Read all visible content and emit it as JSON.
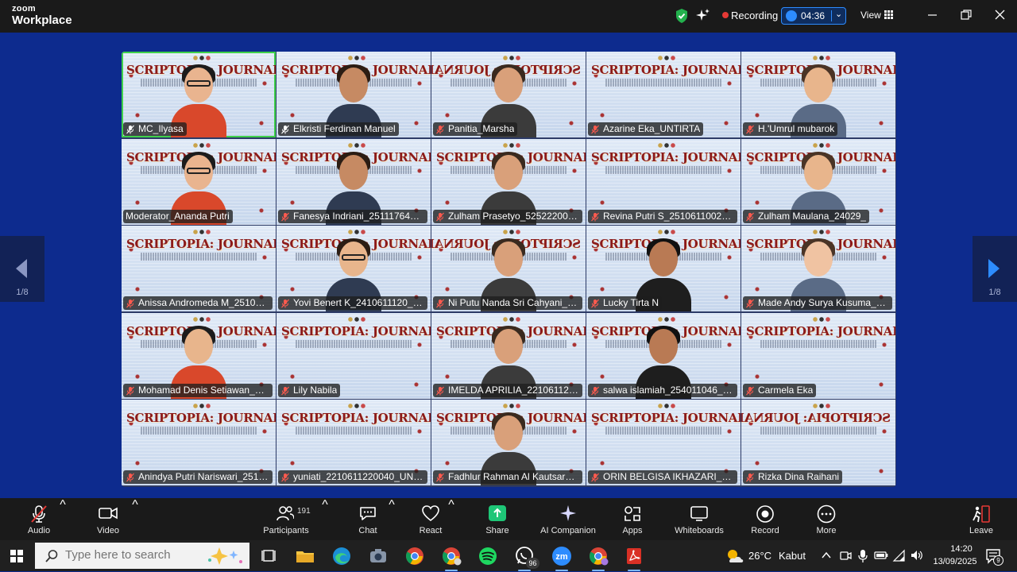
{
  "app": {
    "brand_top": "zoom",
    "brand_bottom": "Workplace"
  },
  "topbar": {
    "recording_label": "Recording",
    "timer": "04:36",
    "view_label": "View"
  },
  "pager": {
    "left_page": "1/8",
    "right_page": "1/8"
  },
  "participants": [
    {
      "name": "MC_Ilyasa",
      "mic": "pinned",
      "video": "person",
      "speaking": true
    },
    {
      "name": "Elkristi Ferdinan Manuel",
      "mic": "pinned",
      "video": "person"
    },
    {
      "name": "Panitia_Marsha",
      "mic": "muted",
      "video": "person",
      "mirrored": true
    },
    {
      "name": "Azarine Eka_UNTIRTA",
      "mic": "muted",
      "video": "banner"
    },
    {
      "name": "H.'Umrul mubarok",
      "mic": "muted",
      "video": "avatar"
    },
    {
      "name": "Moderator_Ananda Putri",
      "mic": "none",
      "video": "person"
    },
    {
      "name": "Fanesya Indriani_2511176403...",
      "mic": "muted",
      "video": "person"
    },
    {
      "name": "Zulham Prasetyo_5252220010...",
      "mic": "muted",
      "video": "person"
    },
    {
      "name": "Revina Putri S_2510611002_U...",
      "mic": "muted",
      "video": "banner"
    },
    {
      "name": "Zulham Maulana_24029_",
      "mic": "muted",
      "video": "avatar"
    },
    {
      "name": "Anissa Andromeda M_251061...",
      "mic": "muted",
      "video": "banner"
    },
    {
      "name": "Yovi Benert K_2410611120_UP...",
      "mic": "muted",
      "video": "avatar"
    },
    {
      "name": "Ni Putu Nanda Sri Cahyani_25...",
      "mic": "muted",
      "video": "person",
      "mirrored": true
    },
    {
      "name": "Lucky Tirta N",
      "mic": "muted",
      "video": "person"
    },
    {
      "name": "Made Andy Surya Kusuma_20...",
      "mic": "muted",
      "video": "person"
    },
    {
      "name": "Mohamad Denis Setiawan_P1...",
      "mic": "muted",
      "video": "avatar"
    },
    {
      "name": "Lily Nabila",
      "mic": "muted",
      "video": "banner"
    },
    {
      "name": "IMELDA APRILIA_22106112200...",
      "mic": "muted",
      "video": "person"
    },
    {
      "name": "salwa islamiah_254011046_po...",
      "mic": "muted",
      "video": "person"
    },
    {
      "name": "Carmela Eka",
      "mic": "muted",
      "video": "banner"
    },
    {
      "name": "Anindya Putri Nariswari_2510...",
      "mic": "muted",
      "video": "banner"
    },
    {
      "name": "yuniati_2210611220040_UNLAM",
      "mic": "muted",
      "video": "banner"
    },
    {
      "name": "Fadhlur Rahman Al Kautsar_ P...",
      "mic": "muted",
      "video": "person"
    },
    {
      "name": "ORIN BELGISA IKHAZARI_254...",
      "mic": "muted",
      "video": "banner"
    },
    {
      "name": "Rizka Dina Raihani",
      "mic": "muted",
      "video": "banner",
      "mirrored": true
    }
  ],
  "banner_text": "SCRIPTOPIA: JOURNAL TALKS",
  "toolbar": {
    "audio": "Audio",
    "video": "Video",
    "participants": "Participants",
    "participant_count": "191",
    "chat": "Chat",
    "react": "React",
    "share": "Share",
    "ai_companion": "AI Companion",
    "apps": "Apps",
    "whiteboards": "Whiteboards",
    "record": "Record",
    "more": "More",
    "leave": "Leave"
  },
  "taskbar": {
    "search_placeholder": "Type here to search",
    "whatsapp_badge": "96",
    "weather_temp": "26°C",
    "weather_condition": "Kabut",
    "time": "14:20",
    "date": "13/09/2025",
    "notification_count": "9"
  },
  "colors": {
    "accent": "#2d8cff",
    "share_green": "#1ec677",
    "recording_red": "#e53935",
    "speaking_border": "#3fd14a",
    "gallery_bg": "#0d2b8e"
  }
}
